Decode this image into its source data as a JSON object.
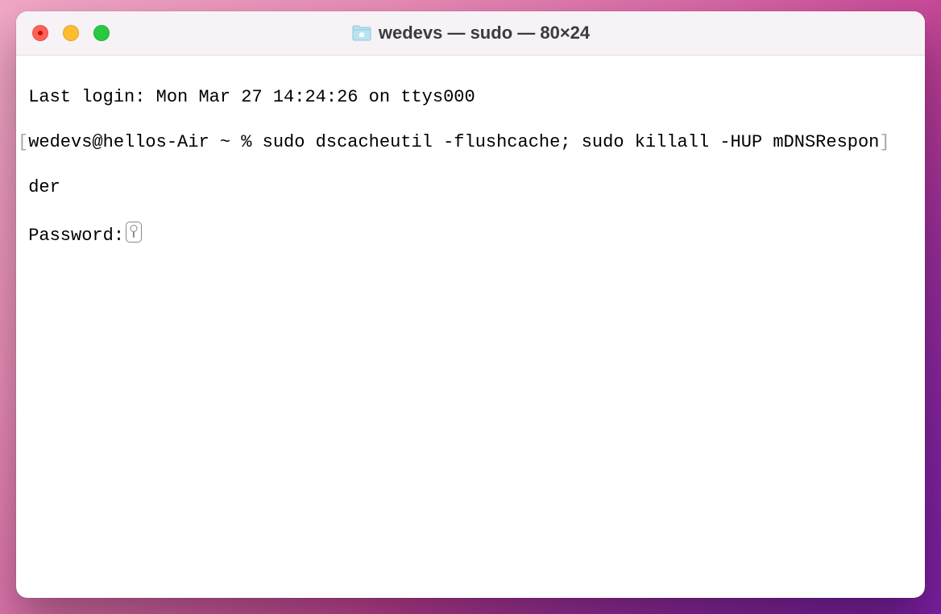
{
  "window": {
    "title": "wedevs — sudo — 80×24",
    "folder_icon_name": "folder-icon"
  },
  "terminal": {
    "last_login": "Last login: Mon Mar 27 14:24:26 on ttys000",
    "bracket_open": "[",
    "prompt_and_cmd": "wedevs@hellos-Air ~ % sudo dscacheutil -flushcache; sudo killall -HUP mDNSRespon",
    "bracket_close": "]",
    "wrapped_cmd_tail": "der",
    "password_label": "Password:"
  }
}
